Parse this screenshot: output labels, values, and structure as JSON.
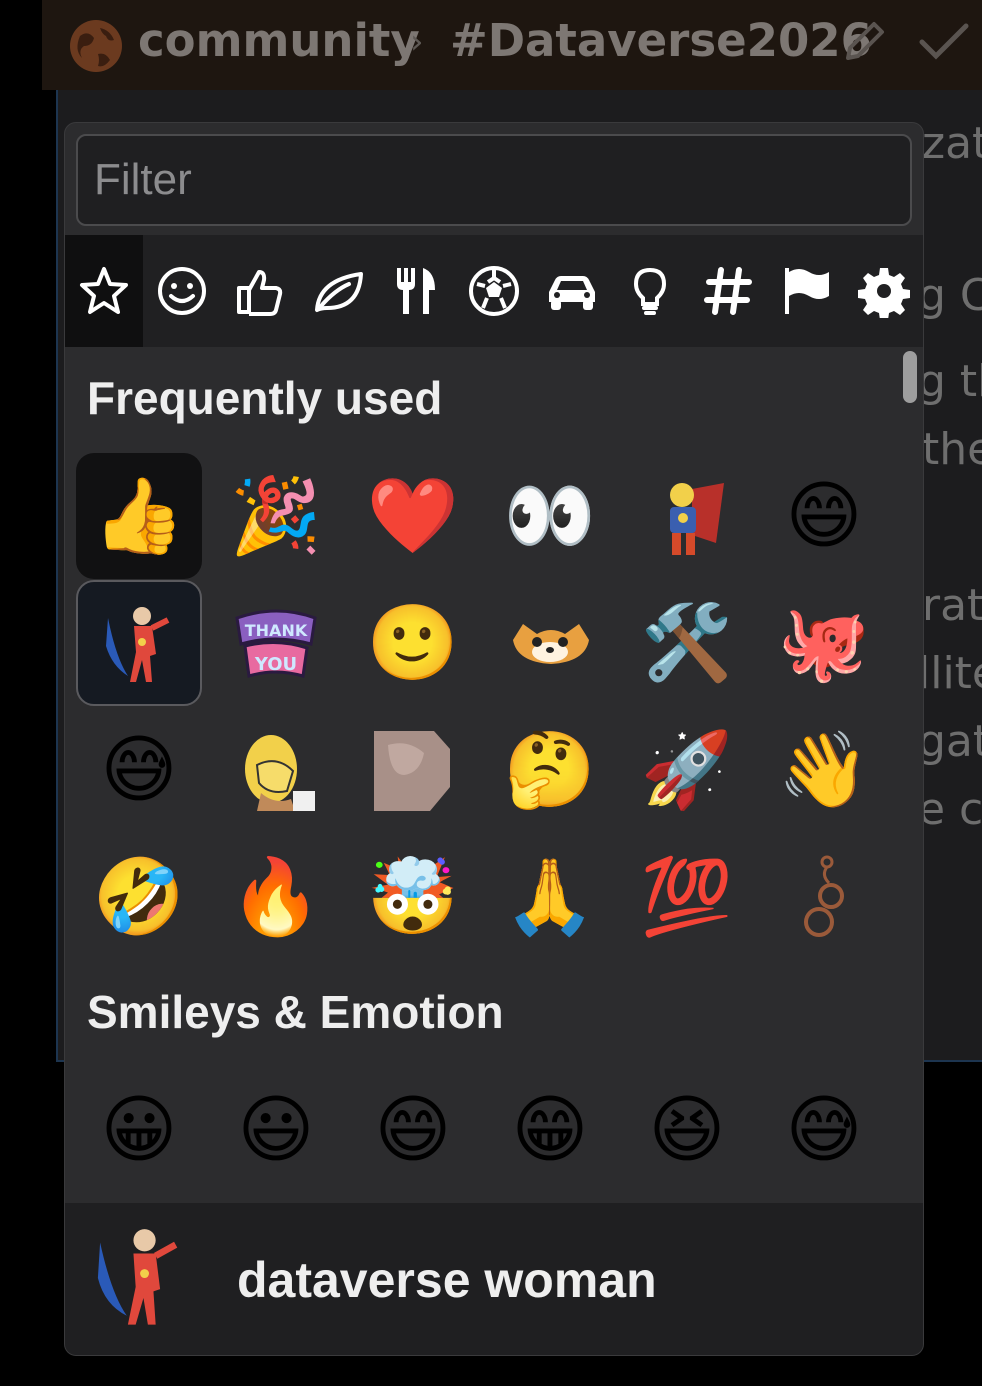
{
  "header": {
    "workspace": "community",
    "channel": "#Dataverse2026",
    "icons": [
      "globe-icon",
      "chevron-right-icon",
      "pencil-icon",
      "check-icon"
    ]
  },
  "background_fragments": [
    "zati",
    "g Co",
    "g th",
    "the",
    "rat",
    "llite",
    "gat",
    "e ca"
  ],
  "picker": {
    "filter_placeholder": "Filter",
    "tabs": [
      {
        "icon": "star-icon",
        "active": true
      },
      {
        "icon": "smiley-icon"
      },
      {
        "icon": "thumbs-up-icon"
      },
      {
        "icon": "leaf-icon"
      },
      {
        "icon": "utensils-icon"
      },
      {
        "icon": "soccer-ball-icon"
      },
      {
        "icon": "car-icon"
      },
      {
        "icon": "lightbulb-icon"
      },
      {
        "icon": "hashtag-icon"
      },
      {
        "icon": "flag-icon"
      },
      {
        "icon": "gear-icon"
      }
    ],
    "sections": [
      {
        "title": "Frequently used",
        "emojis": [
          {
            "glyph": "👍",
            "name": "thumbs-up"
          },
          {
            "glyph": "🎉",
            "name": "party-popper"
          },
          {
            "glyph": "❤️",
            "name": "red-heart"
          },
          {
            "glyph": "👀",
            "name": "eyes"
          },
          {
            "glyph": "",
            "name": "custom-superhero-homer"
          },
          {
            "glyph": "😄",
            "name": "grinning-smiling-eyes"
          },
          {
            "glyph": "",
            "name": "custom-dataverse-woman"
          },
          {
            "glyph": "",
            "name": "custom-thank-you"
          },
          {
            "glyph": "🙂",
            "name": "slightly-smiling"
          },
          {
            "glyph": "",
            "name": "custom-cat-face"
          },
          {
            "glyph": "🛠️",
            "name": "hammer-and-wrench"
          },
          {
            "glyph": "🐙",
            "name": "octopus"
          },
          {
            "glyph": "😅",
            "name": "grinning-sweat"
          },
          {
            "glyph": "",
            "name": "custom-homer-facepalm"
          },
          {
            "glyph": "",
            "name": "custom-photo"
          },
          {
            "glyph": "🤔",
            "name": "thinking"
          },
          {
            "glyph": "🚀",
            "name": "rocket"
          },
          {
            "glyph": "👋",
            "name": "waving-hand"
          },
          {
            "glyph": "🤣",
            "name": "rolling-laughing"
          },
          {
            "glyph": "🔥",
            "name": "fire"
          },
          {
            "glyph": "🤯",
            "name": "exploding-head"
          },
          {
            "glyph": "🙏",
            "name": "folded-hands"
          },
          {
            "glyph": "💯",
            "name": "hundred-points"
          },
          {
            "glyph": "",
            "name": "custom-rings"
          }
        ]
      },
      {
        "title": "Smileys & Emotion",
        "emojis": [
          {
            "glyph": "😀",
            "name": "grinning"
          },
          {
            "glyph": "😃",
            "name": "grinning-big-eyes"
          },
          {
            "glyph": "😄",
            "name": "grinning-smiling-eyes"
          },
          {
            "glyph": "😁",
            "name": "beaming"
          },
          {
            "glyph": "😆",
            "name": "squinting-laughing"
          },
          {
            "glyph": "😅",
            "name": "grinning-sweat"
          }
        ]
      }
    ],
    "preview": {
      "name": "dataverse woman",
      "icon": "custom-dataverse-woman"
    }
  },
  "colors": {
    "picker_bg": "#2c2c2e",
    "tab_bar_bg": "#202022",
    "text": "#eeeeee",
    "muted": "#8c8c8e"
  }
}
